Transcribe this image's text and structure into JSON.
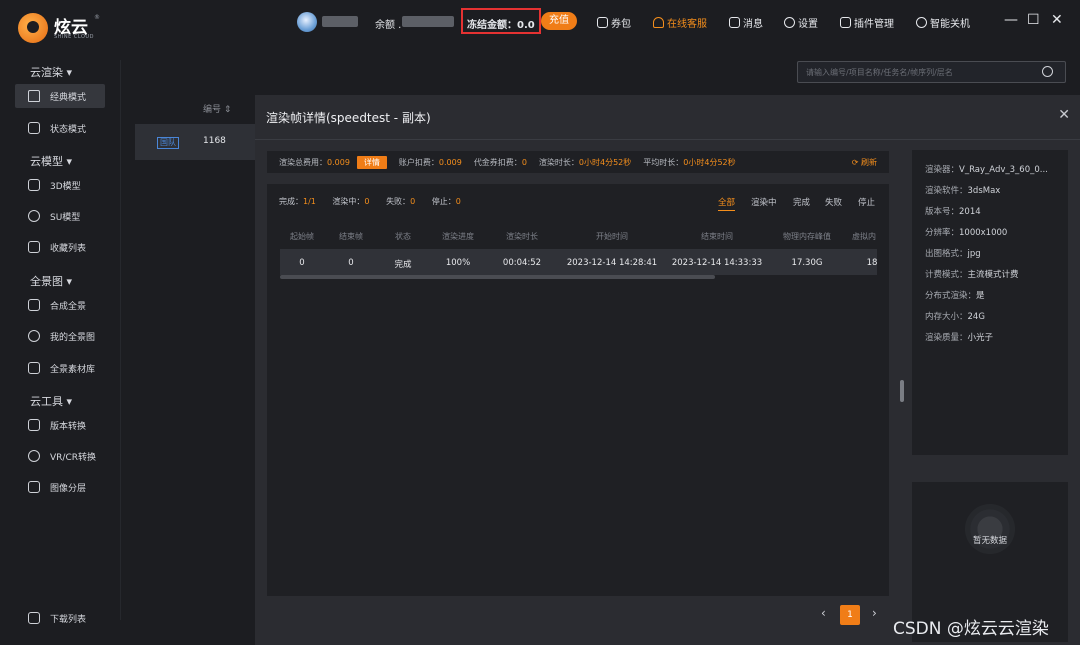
{
  "app": {
    "logo_text": "炫云",
    "logo_sub": "SHINE CLOUD",
    "logo_reg": "®"
  },
  "sidebar": {
    "groups": [
      {
        "label": "云渲染 ▾",
        "items": [
          {
            "label": "经典模式",
            "icon": "house-icon"
          },
          {
            "label": "状态模式",
            "icon": "pulse-icon"
          }
        ]
      },
      {
        "label": "云模型 ▾",
        "items": [
          {
            "label": "3D模型",
            "icon": "cube-icon"
          },
          {
            "label": "SU模型",
            "icon": "su-icon"
          },
          {
            "label": "收藏列表",
            "icon": "bookmark-icon"
          }
        ]
      },
      {
        "label": "全景图 ▾",
        "items": [
          {
            "label": "合成全景",
            "icon": "panorama-icon"
          },
          {
            "label": "我的全景图",
            "icon": "planet-icon"
          },
          {
            "label": "全景素材库",
            "icon": "library-icon"
          }
        ]
      },
      {
        "label": "云工具 ▾",
        "items": [
          {
            "label": "版本转换",
            "icon": "convert-icon"
          },
          {
            "label": "VR/CR转换",
            "icon": "vr-icon"
          },
          {
            "label": "图像分层",
            "icon": "layers-icon"
          }
        ]
      }
    ],
    "download": "下载列表"
  },
  "topbar": {
    "balance_label": "余额 .",
    "frozen": "冻结金额：0.0",
    "recharge": "充值",
    "menu": [
      "券包",
      "在线客服",
      "消息",
      "设置",
      "插件管理",
      "智能关机"
    ],
    "win_min": "—",
    "win_max": "☐",
    "win_close": "✕"
  },
  "background": {
    "search_placeholder": "请输入编号/项目名称/任务名/帧序列/层名",
    "col_header": "编号 ⇕",
    "row_tag": "国队",
    "row_num": "1168"
  },
  "modal": {
    "title": "渲染帧详情(speedtest - 副本)",
    "close": "✕",
    "summary": {
      "total_label": "渲染总费用：",
      "total": "0.009",
      "detail_btn": "详情",
      "account_label": "账户扣费：",
      "account": "0.009",
      "voucher_label": "代金券扣费：",
      "voucher": "0",
      "render_time_label": "渲染时长：",
      "render_time": "0小时4分52秒",
      "avg_time_label": "平均时长：",
      "avg_time": "0小时4分52秒",
      "refresh": "⟳ 刷新"
    },
    "counts": {
      "done_label": "完成：",
      "done": "1/1",
      "rendering_label": "渲染中：",
      "rendering": "0",
      "failed_label": "失败：",
      "failed": "0",
      "stopped_label": "停止：",
      "stopped": "0"
    },
    "filters": [
      "全部",
      "渲染中",
      "完成",
      "失败",
      "停止"
    ],
    "table": {
      "headers": [
        "起始帧",
        "结束帧",
        "状态",
        "渲染进度",
        "渲染时长",
        "开始时间",
        "结束时间",
        "物理内存峰值",
        "虚拟内"
      ],
      "rows": [
        [
          "0",
          "0",
          "完成",
          "100%",
          "00:04:52",
          "2023-12-14 14:28:41",
          "2023-12-14 14:33:33",
          "17.30G",
          "18"
        ]
      ]
    },
    "pager": {
      "prev": "‹",
      "current": "1",
      "next": "›"
    },
    "info": [
      {
        "k": "渲染器：",
        "v": "V_Ray_Adv_3_60_0..."
      },
      {
        "k": "渲染软件：",
        "v": "3dsMax"
      },
      {
        "k": "版本号：",
        "v": "2014"
      },
      {
        "k": "分辨率：",
        "v": "1000x1000"
      },
      {
        "k": "出图格式：",
        "v": "jpg"
      },
      {
        "k": "计费模式：",
        "v": "主流模式计费"
      },
      {
        "k": "分布式渲染：",
        "v": "是"
      },
      {
        "k": "内存大小：",
        "v": "24G"
      },
      {
        "k": "渲染质量：",
        "v": "小光子"
      }
    ],
    "preview_empty": "暂无数据"
  },
  "watermark": "CSDN @炫云云渲染"
}
